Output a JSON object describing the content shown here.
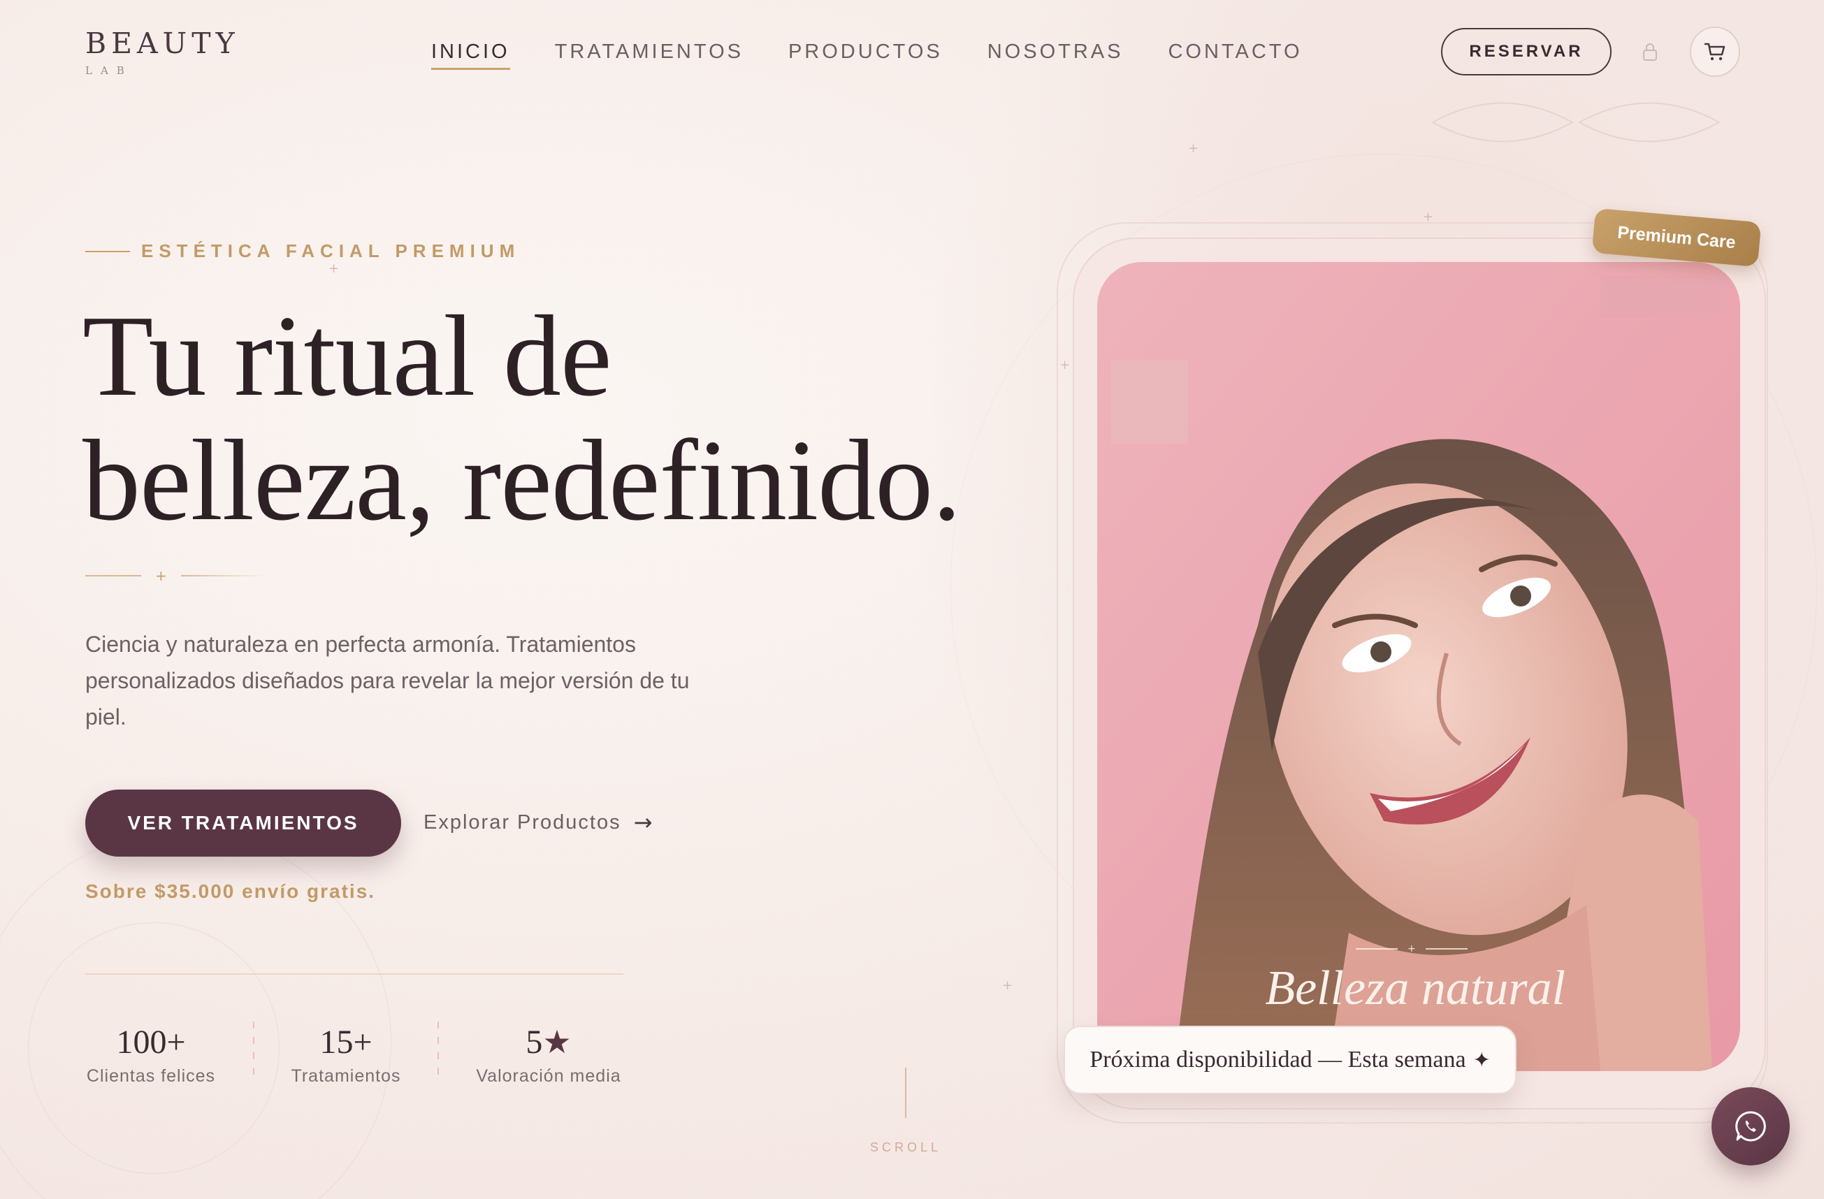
{
  "brand": {
    "name": "BEAUTY",
    "sub": "LAB"
  },
  "nav": {
    "items": [
      {
        "label": "INICIO",
        "active": true
      },
      {
        "label": "TRATAMIENTOS",
        "active": false
      },
      {
        "label": "PRODUCTOS",
        "active": false
      },
      {
        "label": "NOSOTRAS",
        "active": false
      },
      {
        "label": "CONTACTO",
        "active": false
      }
    ]
  },
  "header": {
    "reserve_label": "RESERVAR",
    "lock_icon": "lock-icon",
    "cart_icon": "cart-icon"
  },
  "hero": {
    "eyebrow": "ESTÉTICA FACIAL PREMIUM",
    "headline_line1": "Tu ritual de",
    "headline_line2": "belleza, redefinido.",
    "lead": "Ciencia y naturaleza en perfecta armonía. Tratamientos personalizados diseñados para revelar la mejor versión de tu piel.",
    "cta_primary": "VER TRATAMIENTOS",
    "cta_secondary": "Explorar Productos",
    "cta_secondary_arrow": "→",
    "shipping_note": "Sobre $35.000 envío gratis."
  },
  "stats": [
    {
      "value": "100+",
      "label": "Clientas felices"
    },
    {
      "value": "15+",
      "label": "Tratamientos"
    },
    {
      "value": "5",
      "suffix": "★",
      "label": "Valoración media"
    }
  ],
  "scroll_label": "SCROLL",
  "card": {
    "tag": "Premium Care",
    "caption": "Belleza natural",
    "availability": "Próxima disponibilidad — Esta semana",
    "availability_icon": "✦"
  },
  "colors": {
    "primary": "#5a3645",
    "gold": "#c29a66",
    "text": "#3a2a30",
    "muted": "#6e6065",
    "background": "#f7ece8"
  },
  "floating": {
    "whatsapp_icon": "whatsapp-icon"
  }
}
